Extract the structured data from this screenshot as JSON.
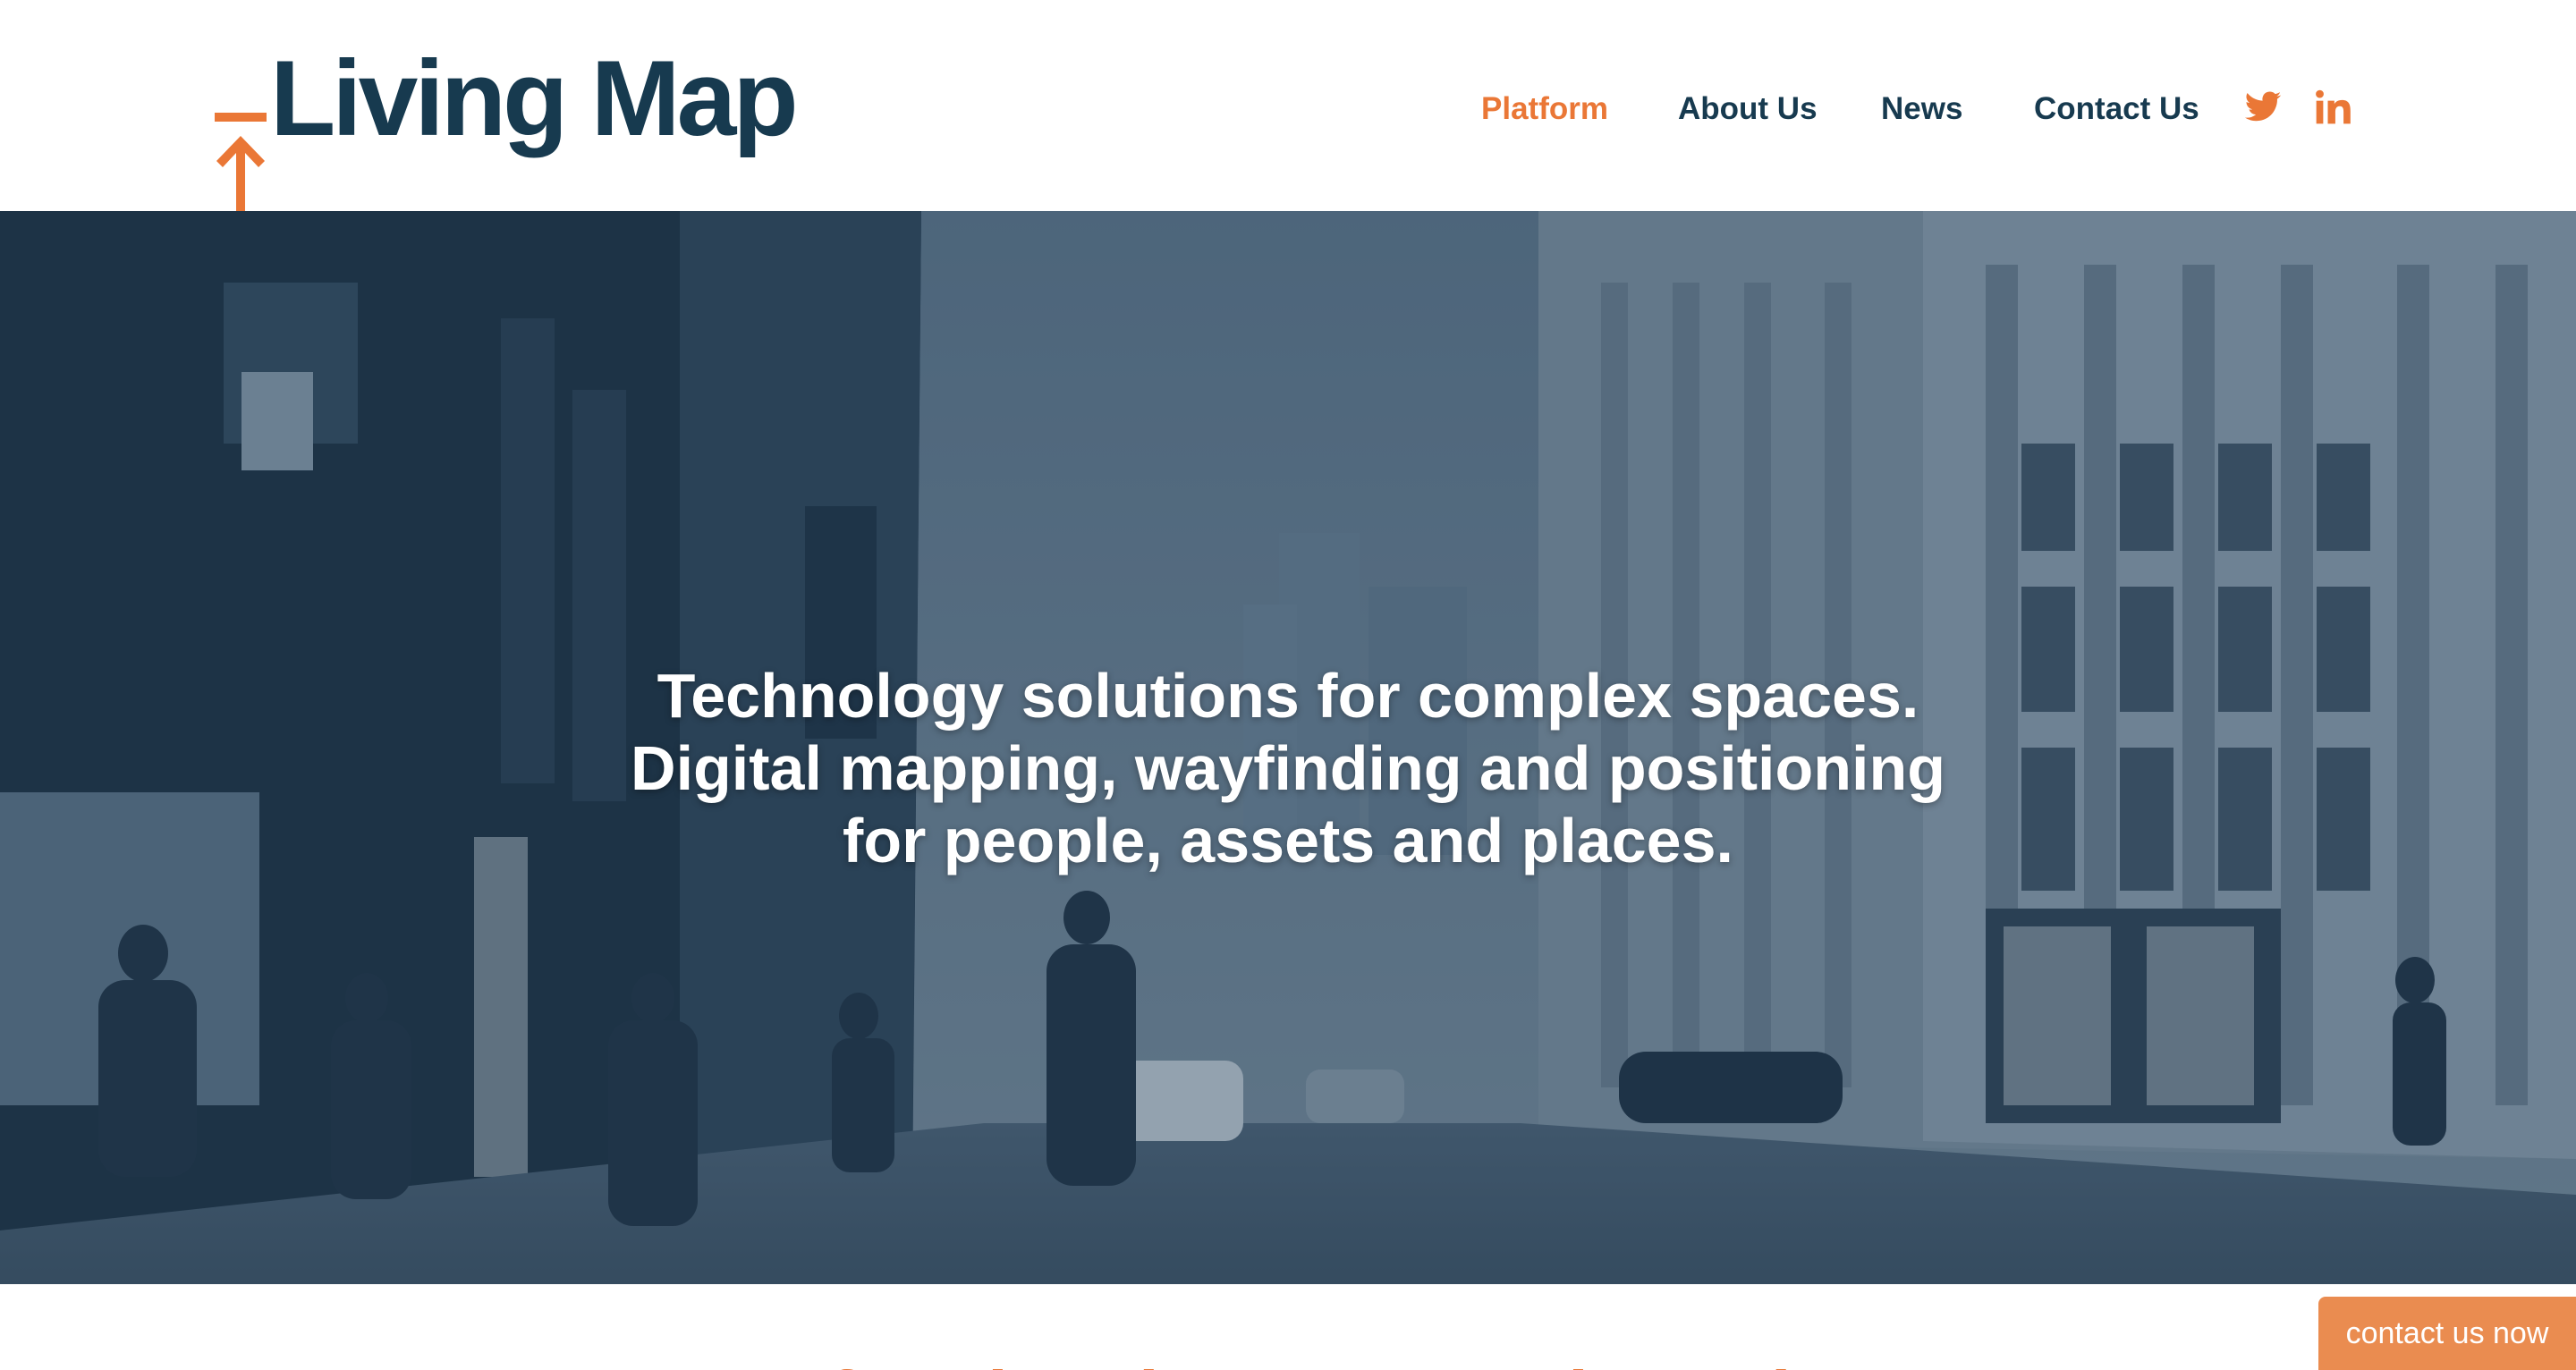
{
  "brand": {
    "name": "Living Map",
    "accent_color": "#ea7736",
    "primary_color": "#173a4f",
    "logo_icon": "arrow-up-icon"
  },
  "nav": {
    "items": [
      {
        "label": "Platform",
        "active": true
      },
      {
        "label": "About Us",
        "active": false
      },
      {
        "label": "News",
        "active": false
      },
      {
        "label": "Contact Us",
        "active": false
      }
    ],
    "social": [
      {
        "icon": "twitter-icon"
      },
      {
        "icon": "linkedin-icon"
      }
    ]
  },
  "hero": {
    "lines": [
      "Technology solutions for complex spaces.",
      "Digital mapping, wayfinding and positioning",
      "for people, assets and places."
    ],
    "background": "city street scene with blue tint overlay",
    "overlay_color": "#2c4a63"
  },
  "section": {
    "title": "Transforming the way people navigate"
  },
  "cta": {
    "label": "contact us now",
    "color": "#ea8c50"
  }
}
